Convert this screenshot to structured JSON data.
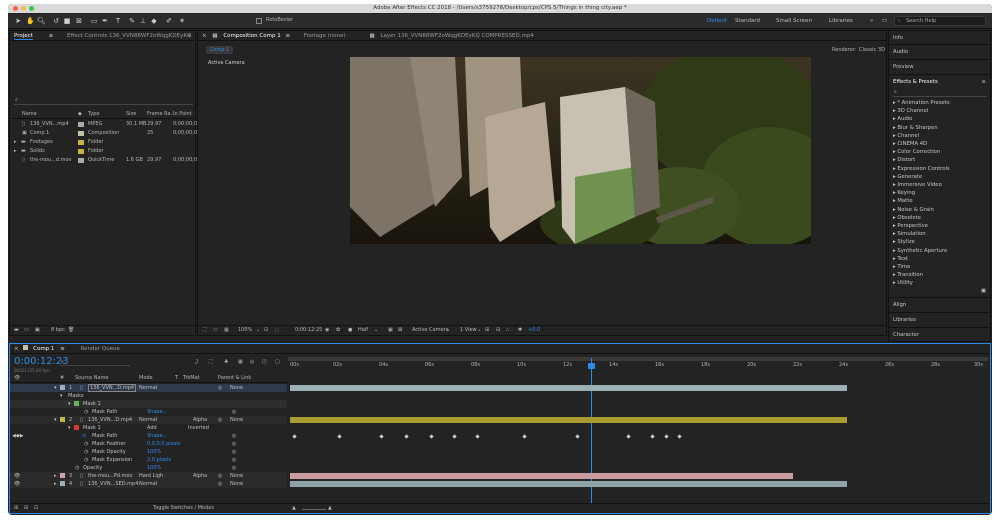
{
  "window": {
    "title": "Adobe After Effects CC 2018 - /Users/s3759278/Desktop/cps/CPS 5/Things in thing city.aep *"
  },
  "toolbar": {
    "rotobrush": "RotoBezier"
  },
  "workspaces": {
    "items": [
      "Default",
      "Standard",
      "Small Screen",
      "Libraries"
    ],
    "more": "»",
    "search": "Search Help"
  },
  "project": {
    "tab": "Project",
    "effect_controls": "Effect Controls 136_VVN88WF2oWqgKDEyKQ",
    "columns": [
      "Name",
      "Type",
      "Size",
      "Frame Ra...",
      "In Point"
    ],
    "rows": [
      {
        "name": "136_VVN...mp4",
        "type": "MPEG",
        "size": "30.1 MB",
        "fr": "29.97",
        "in": "0;00;00;0",
        "color": "#aaaaaa"
      },
      {
        "name": "Comp 1",
        "type": "Composition",
        "size": "",
        "fr": "25",
        "in": "0;00;00;0",
        "color": "#c7c1a3"
      },
      {
        "name": "Footages",
        "type": "Folder",
        "size": "",
        "fr": "",
        "in": "",
        "color": "#c9b43a"
      },
      {
        "name": "Solids",
        "type": "Folder",
        "size": "",
        "fr": "",
        "in": "",
        "color": "#c9b43a"
      },
      {
        "name": "the-mou...d.mov",
        "type": "QuickTime",
        "size": "1.6 GB",
        "fr": "29.97",
        "in": "0;00;00;0",
        "color": "#aaaaaa"
      }
    ],
    "bpc": "8 bpc"
  },
  "viewer": {
    "tabs": [
      "Composition Comp 1",
      "Footage (none)",
      "Layer 136_VVN88WF2oWqgKDEyKQ COMPRESSED.mp4"
    ],
    "subtab": "Comp 1",
    "renderer_label": "Renderer:",
    "renderer": "Classic 3D",
    "camera_label": "Active Camera",
    "zoom": "100%",
    "time": "0;00:12:25",
    "resolution": "Half",
    "camera": "Active Camera",
    "views": "1 View",
    "exposure": "+0.0"
  },
  "right_panel": {
    "top": [
      "Info",
      "Audio",
      "Preview"
    ],
    "effects_title": "Effects & Presets",
    "effects": [
      "* Animation Presets",
      "3D Channel",
      "Audio",
      "Blur & Sharpen",
      "Channel",
      "CINEMA 4D",
      "Color Correction",
      "Distort",
      "Expression Controls",
      "Generate",
      "Immersive Video",
      "Keying",
      "Matte",
      "Noise & Grain",
      "Obsolete",
      "Perspective",
      "Simulation",
      "Stylize",
      "Synthetic Aperture",
      "Text",
      "Time",
      "Transition",
      "Utility"
    ],
    "bottom": [
      "Align",
      "Libraries",
      "Character"
    ]
  },
  "timeline": {
    "tab": "Comp 1",
    "render_queue": "Render Queue",
    "timecode": "0:00:12:23",
    "fps": "00323 (25.00 fps)",
    "columns": [
      "#",
      "Source Name",
      "Mode",
      "T",
      "TrkMat",
      "Parent & Link"
    ],
    "ruler": [
      "00s",
      "02s",
      "04s",
      "06s",
      "08s",
      "10s",
      "12s",
      "14s",
      "16s",
      "18s",
      "20s",
      "22s",
      "24s",
      "26s",
      "28s",
      "30s"
    ],
    "layers": [
      {
        "num": "1",
        "name": "136_VVN...D.mp4",
        "mode": "Normal",
        "trk": "",
        "parent": "None",
        "color": "#9bb0b3"
      },
      {
        "num": "2",
        "name": "136_VVN...D.mp4",
        "mode": "Normal",
        "trk": "Alpha",
        "parent": "None",
        "color": "#c2b43c"
      },
      {
        "num": "3",
        "name": "the-mou...Pd.mov",
        "mode": "Hard Ligh",
        "trk": "Alpha",
        "parent": "None",
        "color": "#cfa3a9"
      },
      {
        "num": "4",
        "name": "136_VVN...SED.mp4",
        "mode": "Normal",
        "trk": "",
        "parent": "None",
        "color": "#9bb0b3"
      }
    ],
    "props": {
      "masks": "Masks",
      "mask1": "Mask 1",
      "mask_path": "Mask Path",
      "shape": "Shape...",
      "add": "Add",
      "inverted": "Inverted",
      "mask_feather": "Mask Feather",
      "feather_val": "0.0,0.0 pixels",
      "mask_opacity": "Mask Opacity",
      "opacity_val": "100%",
      "mask_expansion": "Mask Expansion",
      "expansion_val": "2.0 pixels",
      "opacity": "Opacity",
      "layer_opacity_val": "100%"
    },
    "toggle": "Toggle Switches / Modes"
  }
}
